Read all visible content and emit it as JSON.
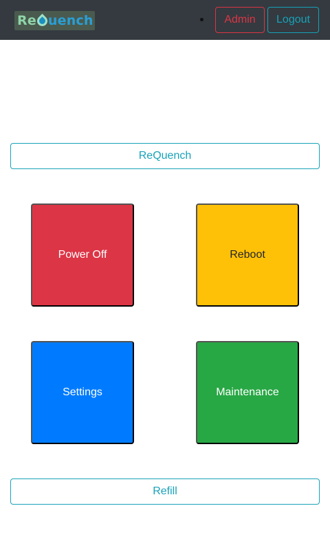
{
  "header": {
    "logo": {
      "part1": "Re",
      "part2": "uench"
    },
    "admin_label": "Admin",
    "logout_label": "Logout"
  },
  "main": {
    "requench_label": "ReQuench",
    "tiles": {
      "power_off": "Power Off",
      "reboot": "Reboot",
      "settings": "Settings",
      "maintenance": "Maintenance"
    },
    "refill_label": "Refill"
  },
  "colors": {
    "navbar": "#343a40",
    "danger": "#dc3545",
    "warning": "#ffc107",
    "primary": "#007bff",
    "success": "#28a745",
    "info": "#17a2b8"
  }
}
